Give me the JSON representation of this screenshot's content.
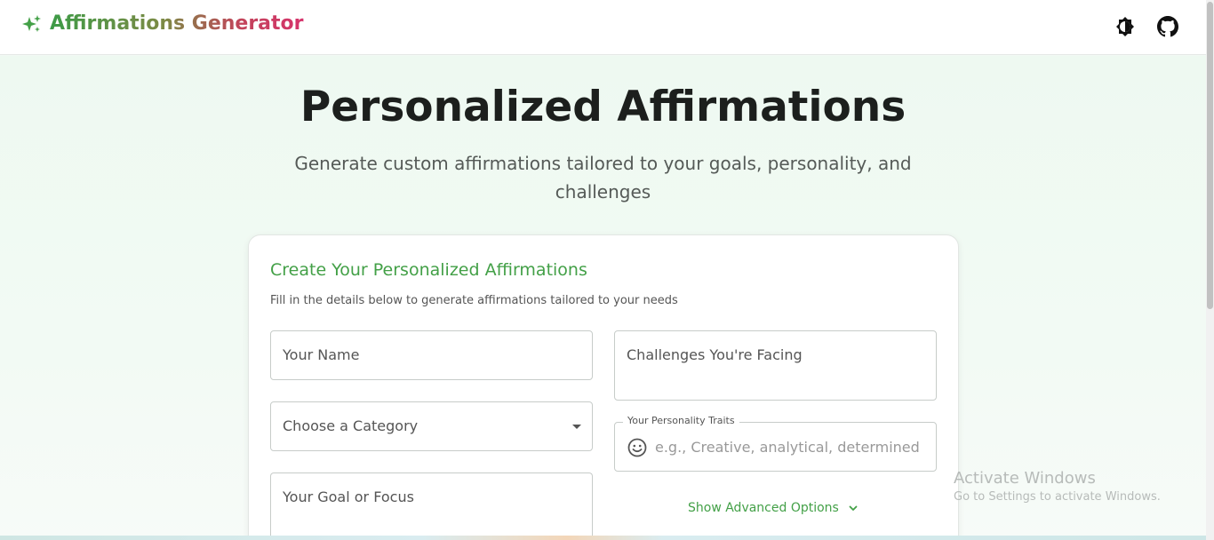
{
  "header": {
    "app_title": "Affirmations Generator",
    "icons": {
      "brand": "sparkle-icon",
      "theme": "theme-toggle-icon",
      "github": "github-icon"
    },
    "gradient": [
      "#3d9b47",
      "#d6336c"
    ]
  },
  "hero": {
    "title": "Personalized Affirmations",
    "subtitle": "Generate custom affirmations tailored to your goals, personality, and challenges"
  },
  "form": {
    "title": "Create Your Personalized Affirmations",
    "subtitle": "Fill in the details below to generate affirmations tailored to your needs",
    "name_label": "Your Name",
    "category_label": "Choose a Category",
    "goal_label": "Your Goal or Focus",
    "challenges_label": "Challenges You're Facing",
    "traits_label": "Your Personality Traits",
    "traits_placeholder": "e.g., Creative, analytical, determined",
    "advanced_label": "Show Advanced Options",
    "accent_color": "#43a047"
  },
  "watermark": {
    "title": "Activate Windows",
    "subtitle": "Go to Settings to activate Windows."
  }
}
